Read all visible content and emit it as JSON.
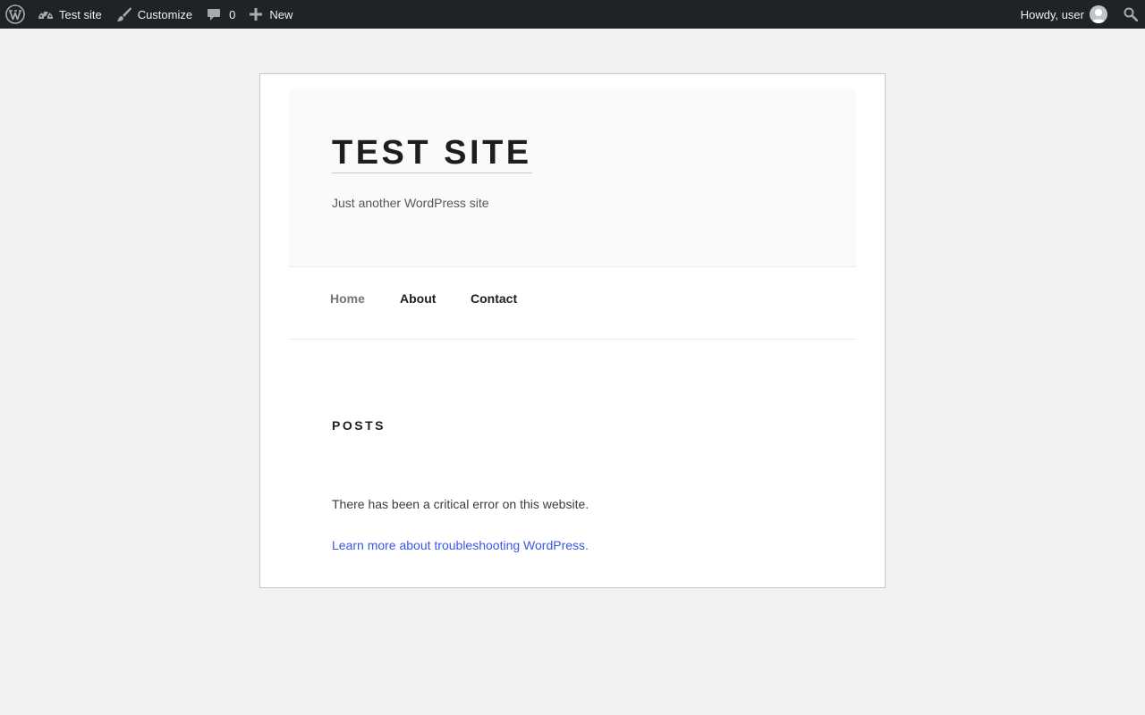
{
  "adminbar": {
    "site_name": "Test site",
    "customize": "Customize",
    "comments_count": "0",
    "new_label": "New",
    "howdy": "Howdy, user"
  },
  "site": {
    "title": "TEST SITE",
    "tagline": "Just another WordPress site"
  },
  "nav": {
    "items": [
      {
        "label": "Home",
        "current": true
      },
      {
        "label": "About",
        "current": false
      },
      {
        "label": "Contact",
        "current": false
      }
    ]
  },
  "content": {
    "posts_heading": "POSTS",
    "error_message": "There has been a critical error on this website.",
    "error_link": "Learn more about troubleshooting WordPress."
  },
  "colors": {
    "adminbar_bg": "#1d2327",
    "page_bg": "#f1f1f1",
    "link": "#3858e9"
  }
}
